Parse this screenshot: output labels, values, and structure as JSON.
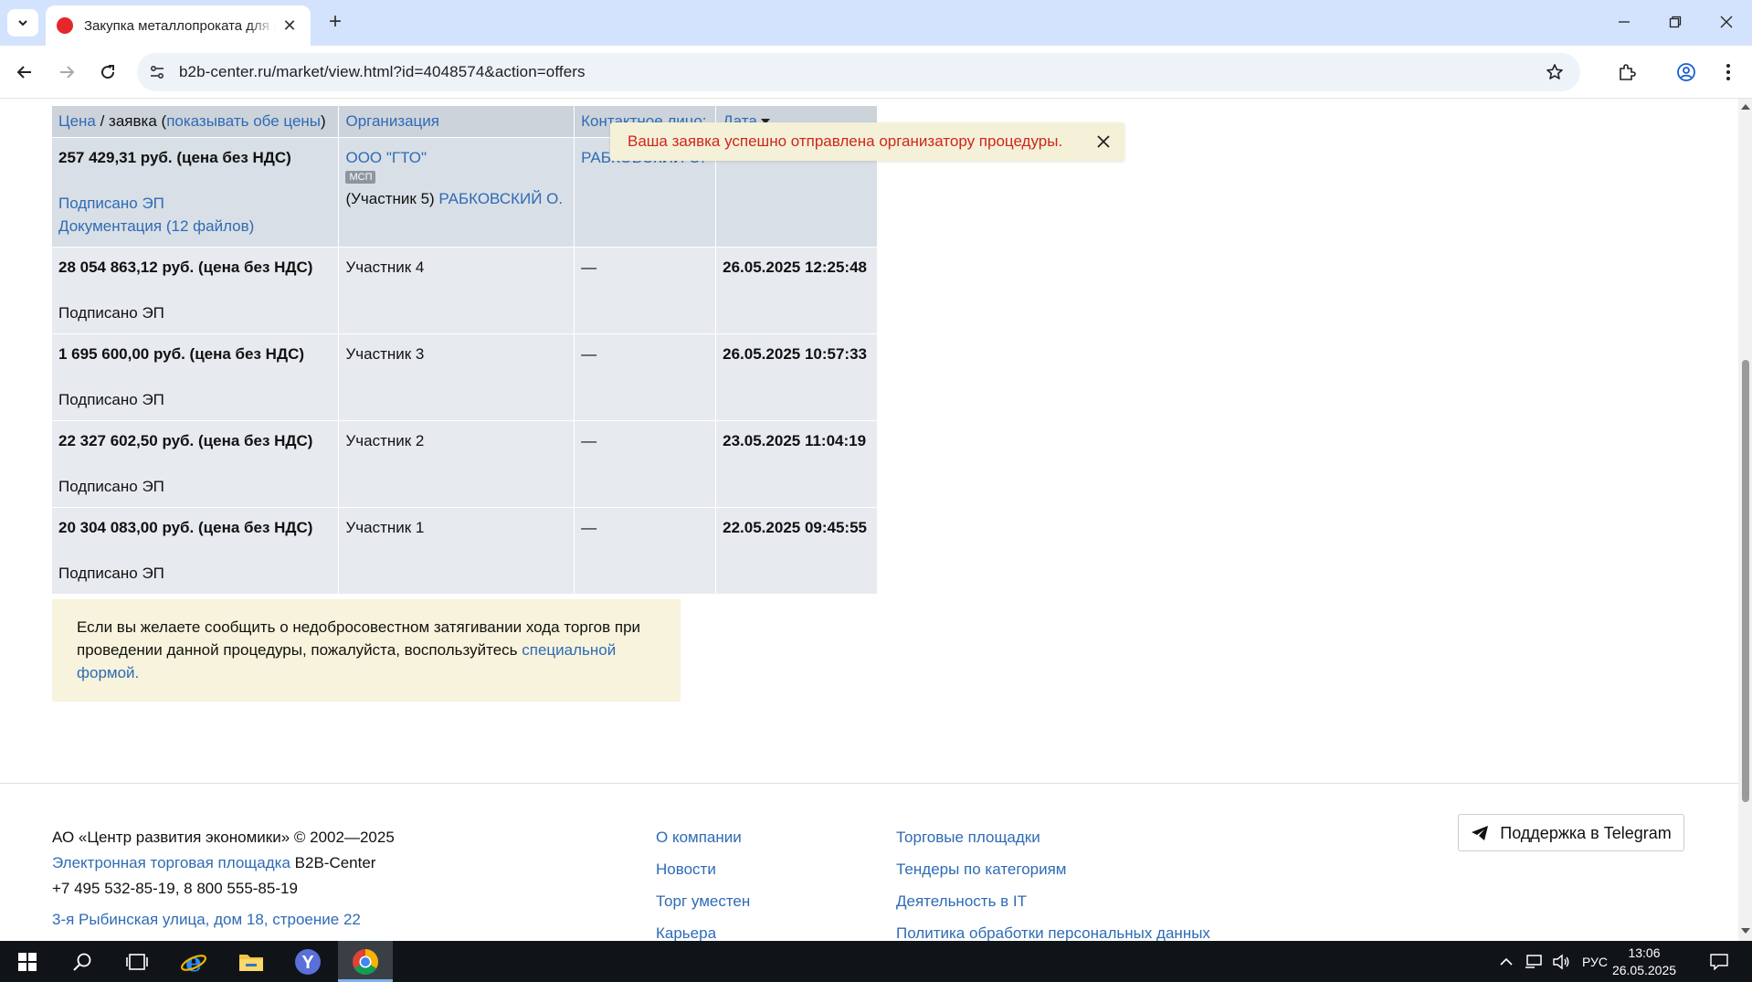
{
  "browser": {
    "tab_title": "Закупка металлопроката для нужд",
    "url": "b2b-center.ru/market/view.html?id=4048574&action=offers"
  },
  "table": {
    "headers": {
      "price_link": "Цена",
      "price_sep": " / заявка (",
      "show_both_link": "показывать обе цены",
      "price_close": ")",
      "organization": "Организация",
      "contact": "Контактное лицо:",
      "date": "Дата"
    },
    "rows": [
      {
        "price": "257 429,31 руб. (цена без НДС)",
        "signed": "Подписано ЭП",
        "docs": "Документация (12 файлов)",
        "org_name": "ООО \"ГТО\"",
        "org_badge": "МСП",
        "participant": "(Участник 5)",
        "participant_contact": "РАБКОВСКИЙ О.",
        "contact": "РАБКОВСКИЙ О.",
        "date": ""
      },
      {
        "price": "28 054 863,12 руб. (цена без НДС)",
        "signed": "Подписано ЭП",
        "participant": "Участник 4",
        "contact": "—",
        "date": "26.05.2025 12:25:48"
      },
      {
        "price": "1 695 600,00 руб. (цена без НДС)",
        "signed": "Подписано ЭП",
        "participant": "Участник 3",
        "contact": "—",
        "date": "26.05.2025 10:57:33"
      },
      {
        "price": "22 327 602,50 руб. (цена без НДС)",
        "signed": "Подписано ЭП",
        "participant": "Участник 2",
        "contact": "—",
        "date": "23.05.2025 11:04:19"
      },
      {
        "price": "20 304 083,00 руб. (цена без НДС)",
        "signed": "Подписано ЭП",
        "participant": "Участник 1",
        "contact": "—",
        "date": "22.05.2025 09:45:55"
      }
    ]
  },
  "toast": {
    "message": "Ваша заявка успешно отправлена организатору процедуры."
  },
  "notice": {
    "text": "Если вы желаете сообщить о недобросовестном затягивании хода торгов при проведении данной процедуры, пожалуйста, воспользуйтесь ",
    "link": "специальной формой."
  },
  "footer": {
    "company": "АО «Центр развития экономики» © 2002—2025",
    "platform_link": "Электронная торговая площадка",
    "platform_name": " B2B-Center",
    "phones": "+7 495 532-85-19, 8 800 555-85-19",
    "address": "3-я Рыбинская улица, дом 18, строение 22",
    "col2": [
      "О компании",
      "Новости",
      "Торг уместен",
      "Карьера"
    ],
    "col3": [
      "Торговые площадки",
      "Тендеры по категориям",
      "Деятельность в IT",
      "Политика обработки персональных данных"
    ],
    "telegram": "Поддержка в Telegram"
  },
  "taskbar": {
    "lang": "РУС",
    "time": "13:06",
    "date": "26.05.2025"
  },
  "colors": {
    "link": "#2e6bb5",
    "toast_text": "#d0261b",
    "header_bg": "#cdd3db"
  }
}
